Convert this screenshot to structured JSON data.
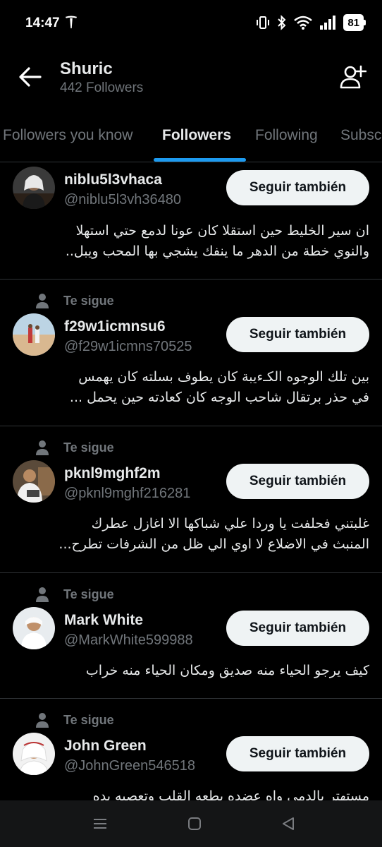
{
  "status_bar": {
    "time": "14:47",
    "battery": "81",
    "icons": [
      "tesla-logo",
      "vibrate-icon",
      "bluetooth-icon",
      "wifi-icon",
      "signal-icon",
      "battery-icon"
    ]
  },
  "header": {
    "name": "Shuric",
    "followers": "442 Followers",
    "icons": [
      "back-arrow-icon",
      "add-user-icon"
    ]
  },
  "tabs": [
    {
      "label": "Followers you know",
      "active": false
    },
    {
      "label": "Followers",
      "active": true
    },
    {
      "label": "Following",
      "active": false
    },
    {
      "label": "Subsc",
      "active": false
    }
  ],
  "follow_button_label": "Seguir también",
  "te_sigue_label": "Te sigue",
  "followers": [
    {
      "name": "niblu5l3vhaca",
      "handle": "@niblu5l3vh36480",
      "bio_lines": [
        "ان سير الخليط حين استقلا كان عونا لدمع حتي استهلا",
        "والنوي خطة من الدهر ما ينفك يشجي بها المحب ويبل.."
      ]
    },
    {
      "name": "f29w1icmnsu6",
      "handle": "@f29w1icmns70525",
      "bio_lines": [
        "بين تلك الوجوه الكـءيبة كان يطوف بسلته كان يهمس",
        "في حذر برتقال شاحب الوجه كان كعادته حين يحمل ..."
      ]
    },
    {
      "name": "pknl9mghf2m",
      "handle": "@pknl9mghf216281",
      "bio_lines": [
        "غلبتني فحلفت يا وردا علي شباكها الا اغازل عطرك",
        "المنبث في الاضلاع لا اوي الي ظل من الشرفات تطرح..."
      ]
    },
    {
      "name": "Mark White",
      "handle": "@MarkWhite599988",
      "bio_lines": [
        "كيف يرجو الحياء منه صديق ومكان الحياء منه خراب"
      ]
    },
    {
      "name": "John Green",
      "handle": "@JohnGreen546518",
      "bio_lines": [
        "مستهتر بالدمي واه عضده بطعه القلب وتعصيه يده"
      ]
    }
  ],
  "colors": {
    "background": "#000000",
    "accent": "#1d9bf0",
    "secondary_text": "#71767b",
    "button_bg": "#eff3f4"
  }
}
